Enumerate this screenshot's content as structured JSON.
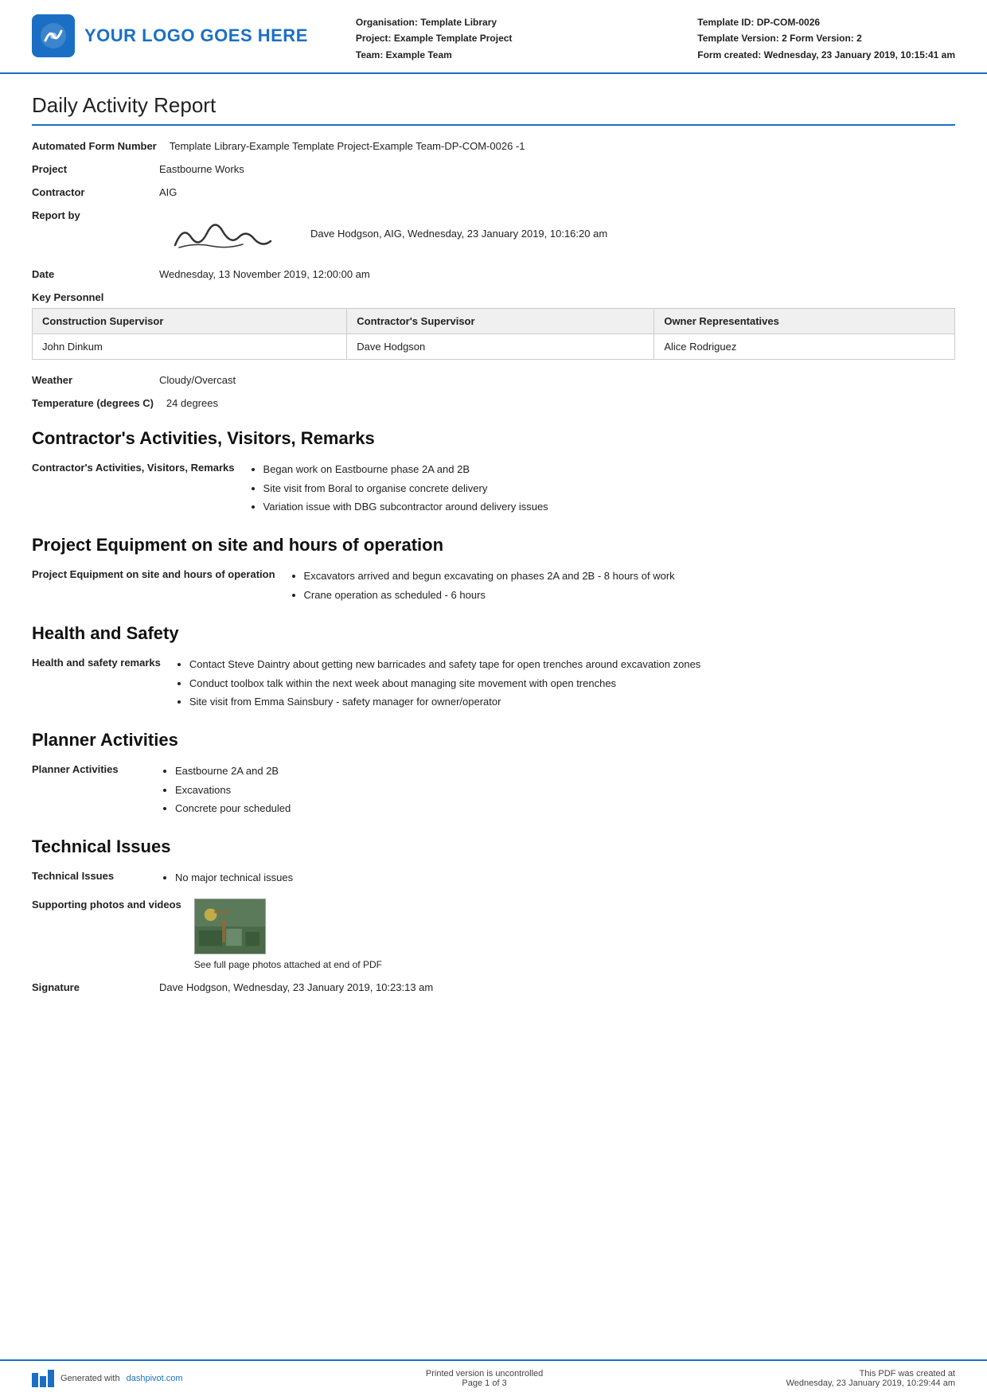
{
  "header": {
    "logo_text": "YOUR LOGO GOES HERE",
    "org_label": "Organisation:",
    "org_value": "Template Library",
    "project_label": "Project:",
    "project_value": "Example Template Project",
    "team_label": "Team:",
    "team_value": "Example Team",
    "template_id_label": "Template ID:",
    "template_id_value": "DP-COM-0026",
    "template_version_label": "Template Version:",
    "template_version_value": "2 Form Version: 2",
    "form_created_label": "Form created:",
    "form_created_value": "Wednesday, 23 January 2019, 10:15:41 am"
  },
  "report": {
    "title": "Daily Activity Report",
    "form_number_label": "Automated Form Number",
    "form_number_value": "Template Library-Example Template Project-Example Team-DP-COM-0026   -1",
    "project_label": "Project",
    "project_value": "Eastbourne Works",
    "contractor_label": "Contractor",
    "contractor_value": "AIG",
    "report_by_label": "Report by",
    "report_by_name": "Dave Hodgson, AIG, Wednesday, 23 January 2019, 10:16:20 am",
    "date_label": "Date",
    "date_value": "Wednesday, 13 November 2019, 12:00:00 am"
  },
  "key_personnel": {
    "section_label": "Key Personnel",
    "col1": "Construction Supervisor",
    "col2": "Contractor's Supervisor",
    "col3": "Owner Representatives",
    "row1_col1": "John Dinkum",
    "row1_col2": "Dave Hodgson",
    "row1_col3": "Alice Rodriguez"
  },
  "weather": {
    "label": "Weather",
    "value": "Cloudy/Overcast",
    "temp_label": "Temperature (degrees C)",
    "temp_value": "24 degrees"
  },
  "contractors_activities": {
    "heading": "Contractor's Activities, Visitors, Remarks",
    "label": "Contractor's Activities, Visitors, Remarks",
    "items": [
      "Began work on Eastbourne phase 2A and 2B",
      "Site visit from Boral to organise concrete delivery",
      "Variation issue with DBG subcontractor around delivery issues"
    ]
  },
  "project_equipment": {
    "heading": "Project Equipment on site and hours of operation",
    "label": "Project Equipment on site and hours of operation",
    "items": [
      "Excavators arrived and begun excavating on phases 2A and 2B - 8 hours of work",
      "Crane operation as scheduled - 6 hours"
    ]
  },
  "health_safety": {
    "heading": "Health and Safety",
    "label": "Health and safety remarks",
    "items": [
      "Contact Steve Daintry about getting new barricades and safety tape for open trenches around excavation zones",
      "Conduct toolbox talk within the next week about managing site movement with open trenches",
      "Site visit from Emma Sainsbury - safety manager for owner/operator"
    ]
  },
  "planner": {
    "heading": "Planner Activities",
    "label": "Planner Activities",
    "items": [
      "Eastbourne 2A and 2B",
      "Excavations",
      "Concrete pour scheduled"
    ]
  },
  "technical_issues": {
    "heading": "Technical Issues",
    "issues_label": "Technical Issues",
    "issues_items": [
      "No major technical issues"
    ],
    "photos_label": "Supporting photos and videos",
    "photos_caption": "See full page photos attached at end of PDF",
    "signature_label": "Signature",
    "signature_value": "Dave Hodgson, Wednesday, 23 January 2019, 10:23:13 am"
  },
  "footer": {
    "generated_text": "Generated with ",
    "link_text": "dashpivot.com",
    "center_text": "Printed version is uncontrolled",
    "page_text": "Page 1 of 3",
    "right_text": "This PDF was created at",
    "right_date": "Wednesday, 23 January 2019, 10:29:44 am"
  }
}
